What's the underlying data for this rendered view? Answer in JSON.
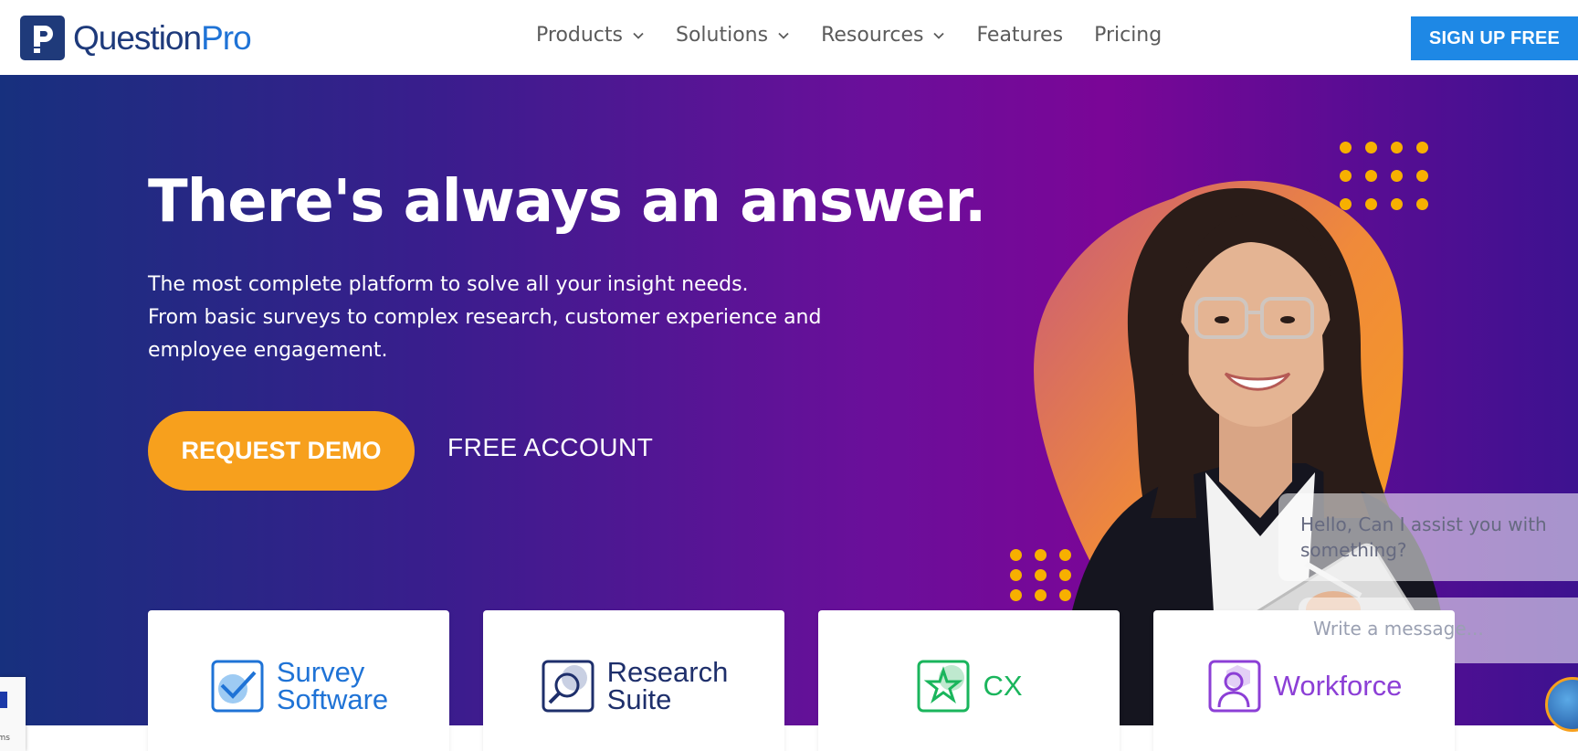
{
  "header": {
    "logo_text_main": "Question",
    "logo_text_pro": "Pro",
    "nav": [
      {
        "label": "Products",
        "has_dropdown": true
      },
      {
        "label": "Solutions",
        "has_dropdown": true
      },
      {
        "label": "Resources",
        "has_dropdown": true
      },
      {
        "label": "Features",
        "has_dropdown": false
      },
      {
        "label": "Pricing",
        "has_dropdown": false
      }
    ],
    "signup_label": "SIGN UP FREE"
  },
  "hero": {
    "title": "There's always an answer.",
    "subtitle_lines": [
      "The most complete platform to solve all your insight needs.",
      "From basic surveys to complex research, customer experience and",
      "employee engagement."
    ],
    "primary_cta": "REQUEST DEMO",
    "secondary_cta": "FREE ACCOUNT"
  },
  "cards": [
    {
      "label_lines": [
        "Survey",
        "Software"
      ],
      "icon": "checkbox-icon",
      "color": "#1f73d6"
    },
    {
      "label_lines": [
        "Research",
        "Suite"
      ],
      "icon": "magnifier-icon",
      "color": "#1e2f6b"
    },
    {
      "label_lines": [
        "CX"
      ],
      "icon": "star-icon",
      "color": "#1ab55c"
    },
    {
      "label_lines": [
        "Workforce"
      ],
      "icon": "person-icon",
      "color": "#8c3fd6"
    }
  ],
  "chat": {
    "greeting": "Hello, Can I assist you with something?",
    "input_placeholder": "Write a message..."
  },
  "recaptcha": {
    "text": "rms"
  },
  "colors": {
    "brand_blue": "#1e88e5",
    "navy": "#1e3a7b",
    "cta_orange": "#f7a01d",
    "dot_yellow": "#f7b000"
  }
}
